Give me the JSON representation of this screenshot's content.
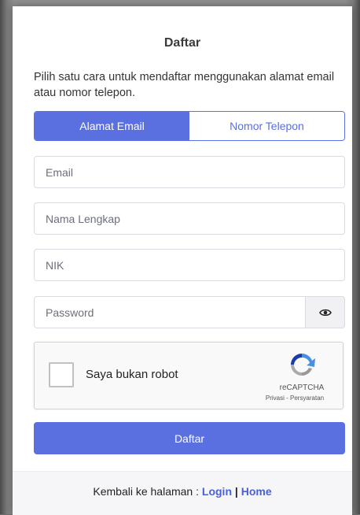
{
  "form": {
    "title": "Daftar",
    "description": "Pilih satu cara untuk mendaftar menggunakan alamat email atau nomor telepon.",
    "tabs": [
      {
        "label": "Alamat Email",
        "active": true
      },
      {
        "label": "Nomor Telepon",
        "active": false
      }
    ],
    "fields": {
      "email_placeholder": "Email",
      "name_placeholder": "Nama Lengkap",
      "nik_placeholder": "NIK",
      "password_placeholder": "Password"
    },
    "password_toggle_icon": "eye-icon",
    "captcha": {
      "label": "Saya bukan robot",
      "brand": "reCAPTCHA",
      "privacy": "Privasi",
      "separator": " - ",
      "terms": "Persyaratan"
    },
    "submit_label": "Daftar"
  },
  "footer": {
    "prefix": "Kembali ke halaman : ",
    "login_label": "Login",
    "separator": " | ",
    "home_label": "Home"
  },
  "colors": {
    "accent": "#5a6fe0",
    "link": "#4b5fd9"
  }
}
